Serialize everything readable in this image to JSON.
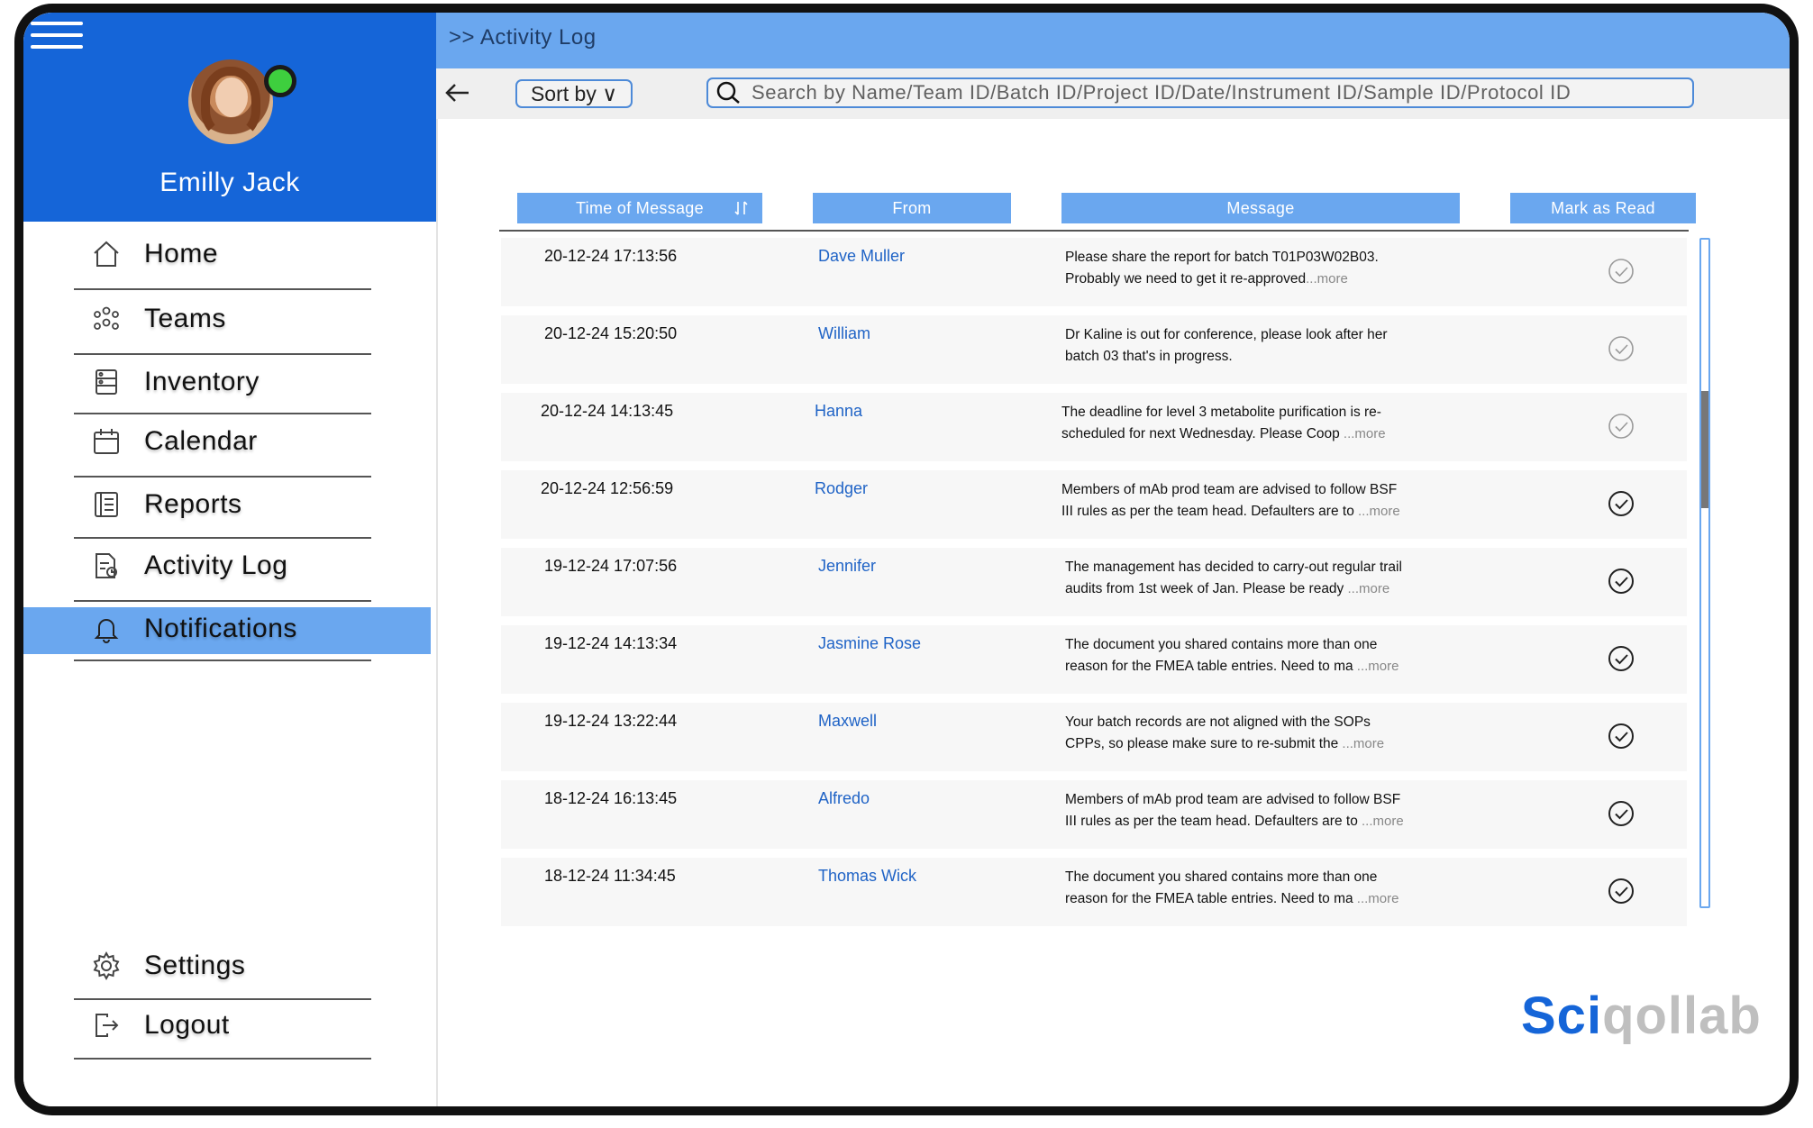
{
  "user": {
    "name": "Emilly Jack"
  },
  "sidebar": {
    "items": [
      {
        "label": "Home",
        "icon": "home-icon"
      },
      {
        "label": "Teams",
        "icon": "teams-icon"
      },
      {
        "label": "Inventory",
        "icon": "inventory-icon"
      },
      {
        "label": "Calendar",
        "icon": "calendar-icon"
      },
      {
        "label": "Reports",
        "icon": "reports-icon"
      },
      {
        "label": "Activity Log",
        "icon": "activity-log-icon"
      },
      {
        "label": "Notifications",
        "icon": "bell-icon",
        "active": true
      }
    ],
    "bottom": [
      {
        "label": "Settings",
        "icon": "gear-icon"
      },
      {
        "label": "Logout",
        "icon": "logout-icon"
      }
    ]
  },
  "header": {
    "breadcrumb": ">> Activity Log"
  },
  "toolbar": {
    "sort_label": "Sort by ∨",
    "search_placeholder": "Search by Name/Team ID/Batch ID/Project ID/Date/Instrument ID/Sample ID/Protocol ID"
  },
  "table": {
    "columns": [
      "Time of Message",
      "From",
      "Message",
      "Mark as Read"
    ],
    "rows": [
      {
        "time": "20-12-24 17:13:56",
        "from": "Dave Muller",
        "line1": "Please share the report for batch T01P03W02B03.",
        "line2": "Probably we need to get it re-approved",
        "more": "...more",
        "read": false
      },
      {
        "time": "20-12-24 15:20:50",
        "from": "William",
        "line1": "Dr Kaline is out for conference, please look after her",
        "line2": "batch 03 that's in progress.",
        "more": "",
        "read": false
      },
      {
        "time": "20-12-24 14:13:45",
        "from": "Hanna",
        "line1": "The deadline for level 3 metabolite purification is re-",
        "line2": "scheduled for next Wednesday. Please Coop",
        "more": " ...more",
        "read": false
      },
      {
        "time": "20-12-24 12:56:59",
        "from": "Rodger",
        "line1": "Members of mAb prod team are advised to follow BSF",
        "line2": "III rules as per the team head. Defaulters are to",
        "more": " ...more",
        "read": true
      },
      {
        "time": "19-12-24 17:07:56",
        "from": "Jennifer",
        "line1": "The management has decided to carry-out regular trail",
        "line2": "audits from 1st week of Jan. Please be ready",
        "more": " ...more",
        "read": true
      },
      {
        "time": "19-12-24 14:13:34",
        "from": "Jasmine Rose",
        "line1": "The document you shared contains more than one",
        "line2": "reason for the FMEA table entries. Need to ma",
        "more": " ...more",
        "read": true
      },
      {
        "time": "19-12-24 13:22:44",
        "from": "Maxwell",
        "line1": "Your batch records are not aligned with the SOPs",
        "line2": "CPPs, so please make sure to re-submit the",
        "more": "  ...more",
        "read": true
      },
      {
        "time": "18-12-24 16:13:45",
        "from": "Alfredo",
        "line1": "Members of mAb prod team are advised to follow BSF",
        "line2": "III rules as per the team head. Defaulters are to",
        "more": " ...more",
        "read": true
      },
      {
        "time": "18-12-24 11:34:45",
        "from": "Thomas Wick",
        "line1": "The document you shared contains more than one",
        "line2": "reason for the FMEA table entries. Need to ma",
        "more": " ...more",
        "read": true
      }
    ]
  },
  "brand": {
    "part1": "Sci",
    "part2": "qollab"
  },
  "colors": {
    "primary": "#1565d8",
    "accent": "#6aa7ef",
    "link": "#1f63c6"
  }
}
